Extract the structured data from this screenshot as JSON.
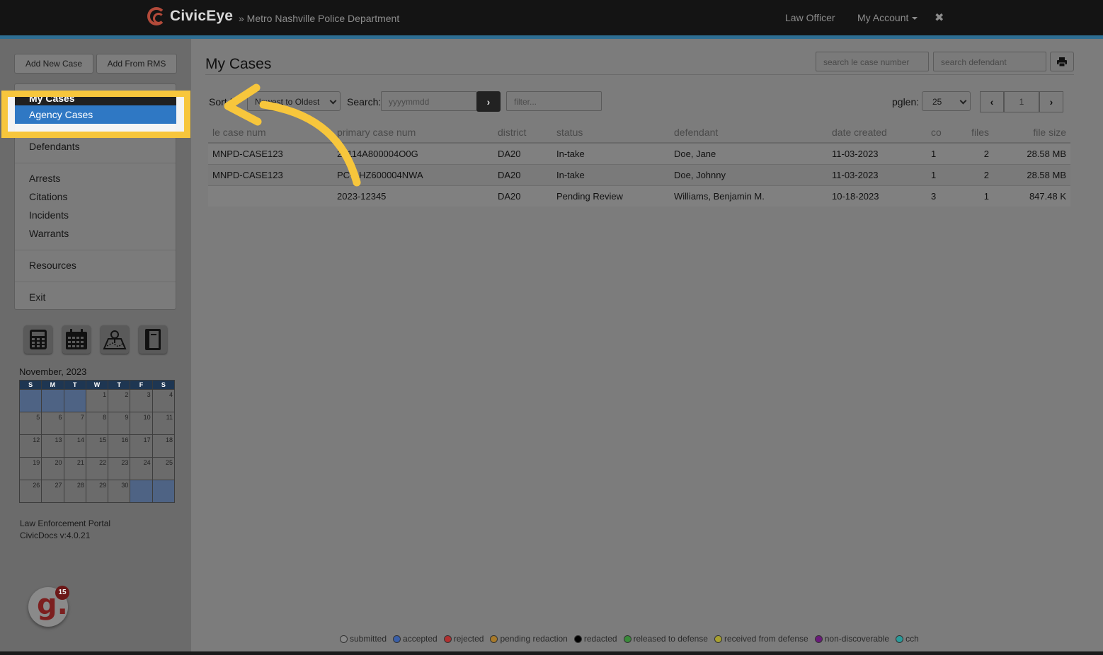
{
  "navbar": {
    "brand": "CivicEye",
    "org": "» Metro Nashville Police Department",
    "role": "Law Officer",
    "account": "My Account",
    "close_glyph": "✖"
  },
  "sidebar": {
    "add_new_case": "Add New Case",
    "add_from_rms": "Add From RMS",
    "menu_my_cases": "My Cases",
    "menu_agency_cases": "Agency Cases",
    "menu_defendants": "Defendants",
    "menu_arrests": "Arrests",
    "menu_citations": "Citations",
    "menu_incidents": "Incidents",
    "menu_warrants": "Warrants",
    "menu_resources": "Resources",
    "menu_exit": "Exit",
    "icons": [
      "calculator-icon",
      "calendar-icon",
      "map-icon",
      "notebook-icon"
    ]
  },
  "calendar": {
    "title": "November, 2023",
    "days": [
      "S",
      "M",
      "T",
      "W",
      "T",
      "F",
      "S"
    ],
    "weeks": [
      [
        "",
        "",
        "",
        "1",
        "2",
        "3",
        "4"
      ],
      [
        "5",
        "6",
        "7",
        "8",
        "9",
        "10",
        "11"
      ],
      [
        "12",
        "13",
        "14",
        "15",
        "16",
        "17",
        "18"
      ],
      [
        "19",
        "20",
        "21",
        "22",
        "23",
        "24",
        "25"
      ],
      [
        "26",
        "27",
        "28",
        "29",
        "30",
        "",
        ""
      ]
    ]
  },
  "footer": {
    "portal": "Law Enforcement Portal",
    "version": "CivicDocs v:4.0.21"
  },
  "notifications": {
    "letter": "g.",
    "count": "15"
  },
  "main": {
    "title": "My Cases",
    "search_case_placeholder": "search le case number",
    "search_defendant_placeholder": "search defendant",
    "sort_label": "Sort F",
    "sort_value": "Newest to Oldest",
    "search_label": "Search:",
    "date_placeholder": "yyyymmdd",
    "filter_placeholder": "filter...",
    "pglen_label": "pglen:",
    "pglen_value": "25",
    "page_number": "1"
  },
  "table": {
    "columns": [
      "le case num",
      "primary case num",
      "district",
      "status",
      "defendant",
      "date created",
      "co",
      "files",
      "file size"
    ],
    "rows": [
      [
        "MNPD-CASE123",
        "20114A800004O0G",
        "DA20",
        "In-take",
        "Doe, Jane",
        "11-03-2023",
        "1",
        "2",
        "28.58 MB"
      ],
      [
        "MNPD-CASE123",
        "PC-AHZ600004NWA",
        "DA20",
        "In-take",
        "Doe, Johnny",
        "11-03-2023",
        "1",
        "2",
        "28.58 MB"
      ],
      [
        "",
        "2023-12345",
        "DA20",
        "Pending Review",
        "Williams, Benjamin M.",
        "10-18-2023",
        "3",
        "1",
        "847.48 K"
      ]
    ]
  },
  "legend": [
    {
      "label": "submitted",
      "color": "#8a8a8a"
    },
    {
      "label": "accepted",
      "color": "#3a5fa8"
    },
    {
      "label": "rejected",
      "color": "#b03030"
    },
    {
      "label": "pending redaction",
      "color": "#a87a2a"
    },
    {
      "label": "redacted",
      "color": "#000000"
    },
    {
      "label": "released to defense",
      "color": "#3a8a3a"
    },
    {
      "label": "received from defense",
      "color": "#a8a030"
    },
    {
      "label": "non-discoverable",
      "color": "#6a1a7a"
    },
    {
      "label": "cch",
      "color": "#2a9a9a"
    }
  ],
  "colors": {
    "highlight": "#f7c63c",
    "arrow": "#f7c63c",
    "active_item": "#2f78c4"
  }
}
